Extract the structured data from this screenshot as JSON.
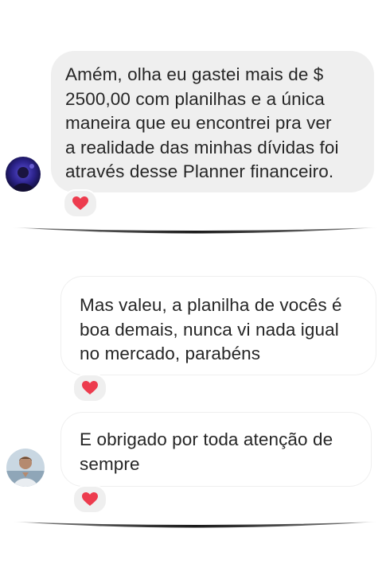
{
  "messages": [
    {
      "text": "Amém, olha eu gastei mais de $\n2500,00 com planilhas  e a única\nmaneira que eu encontrei pra ver\na realidade das minhas dívidas foi\natravés desse Planner financeiro.",
      "reaction": "heart"
    },
    {
      "text": "Mas valeu, a planilha de vocês é\nboa demais, nunca vi nada igual\nno mercado, parabéns",
      "reaction": "heart"
    },
    {
      "text": "E obrigado por toda atenção de\nsempre",
      "reaction": "heart"
    }
  ],
  "colors": {
    "bubble_gray": "#efefef",
    "text": "#262626",
    "heart": "#ed3c4e"
  }
}
